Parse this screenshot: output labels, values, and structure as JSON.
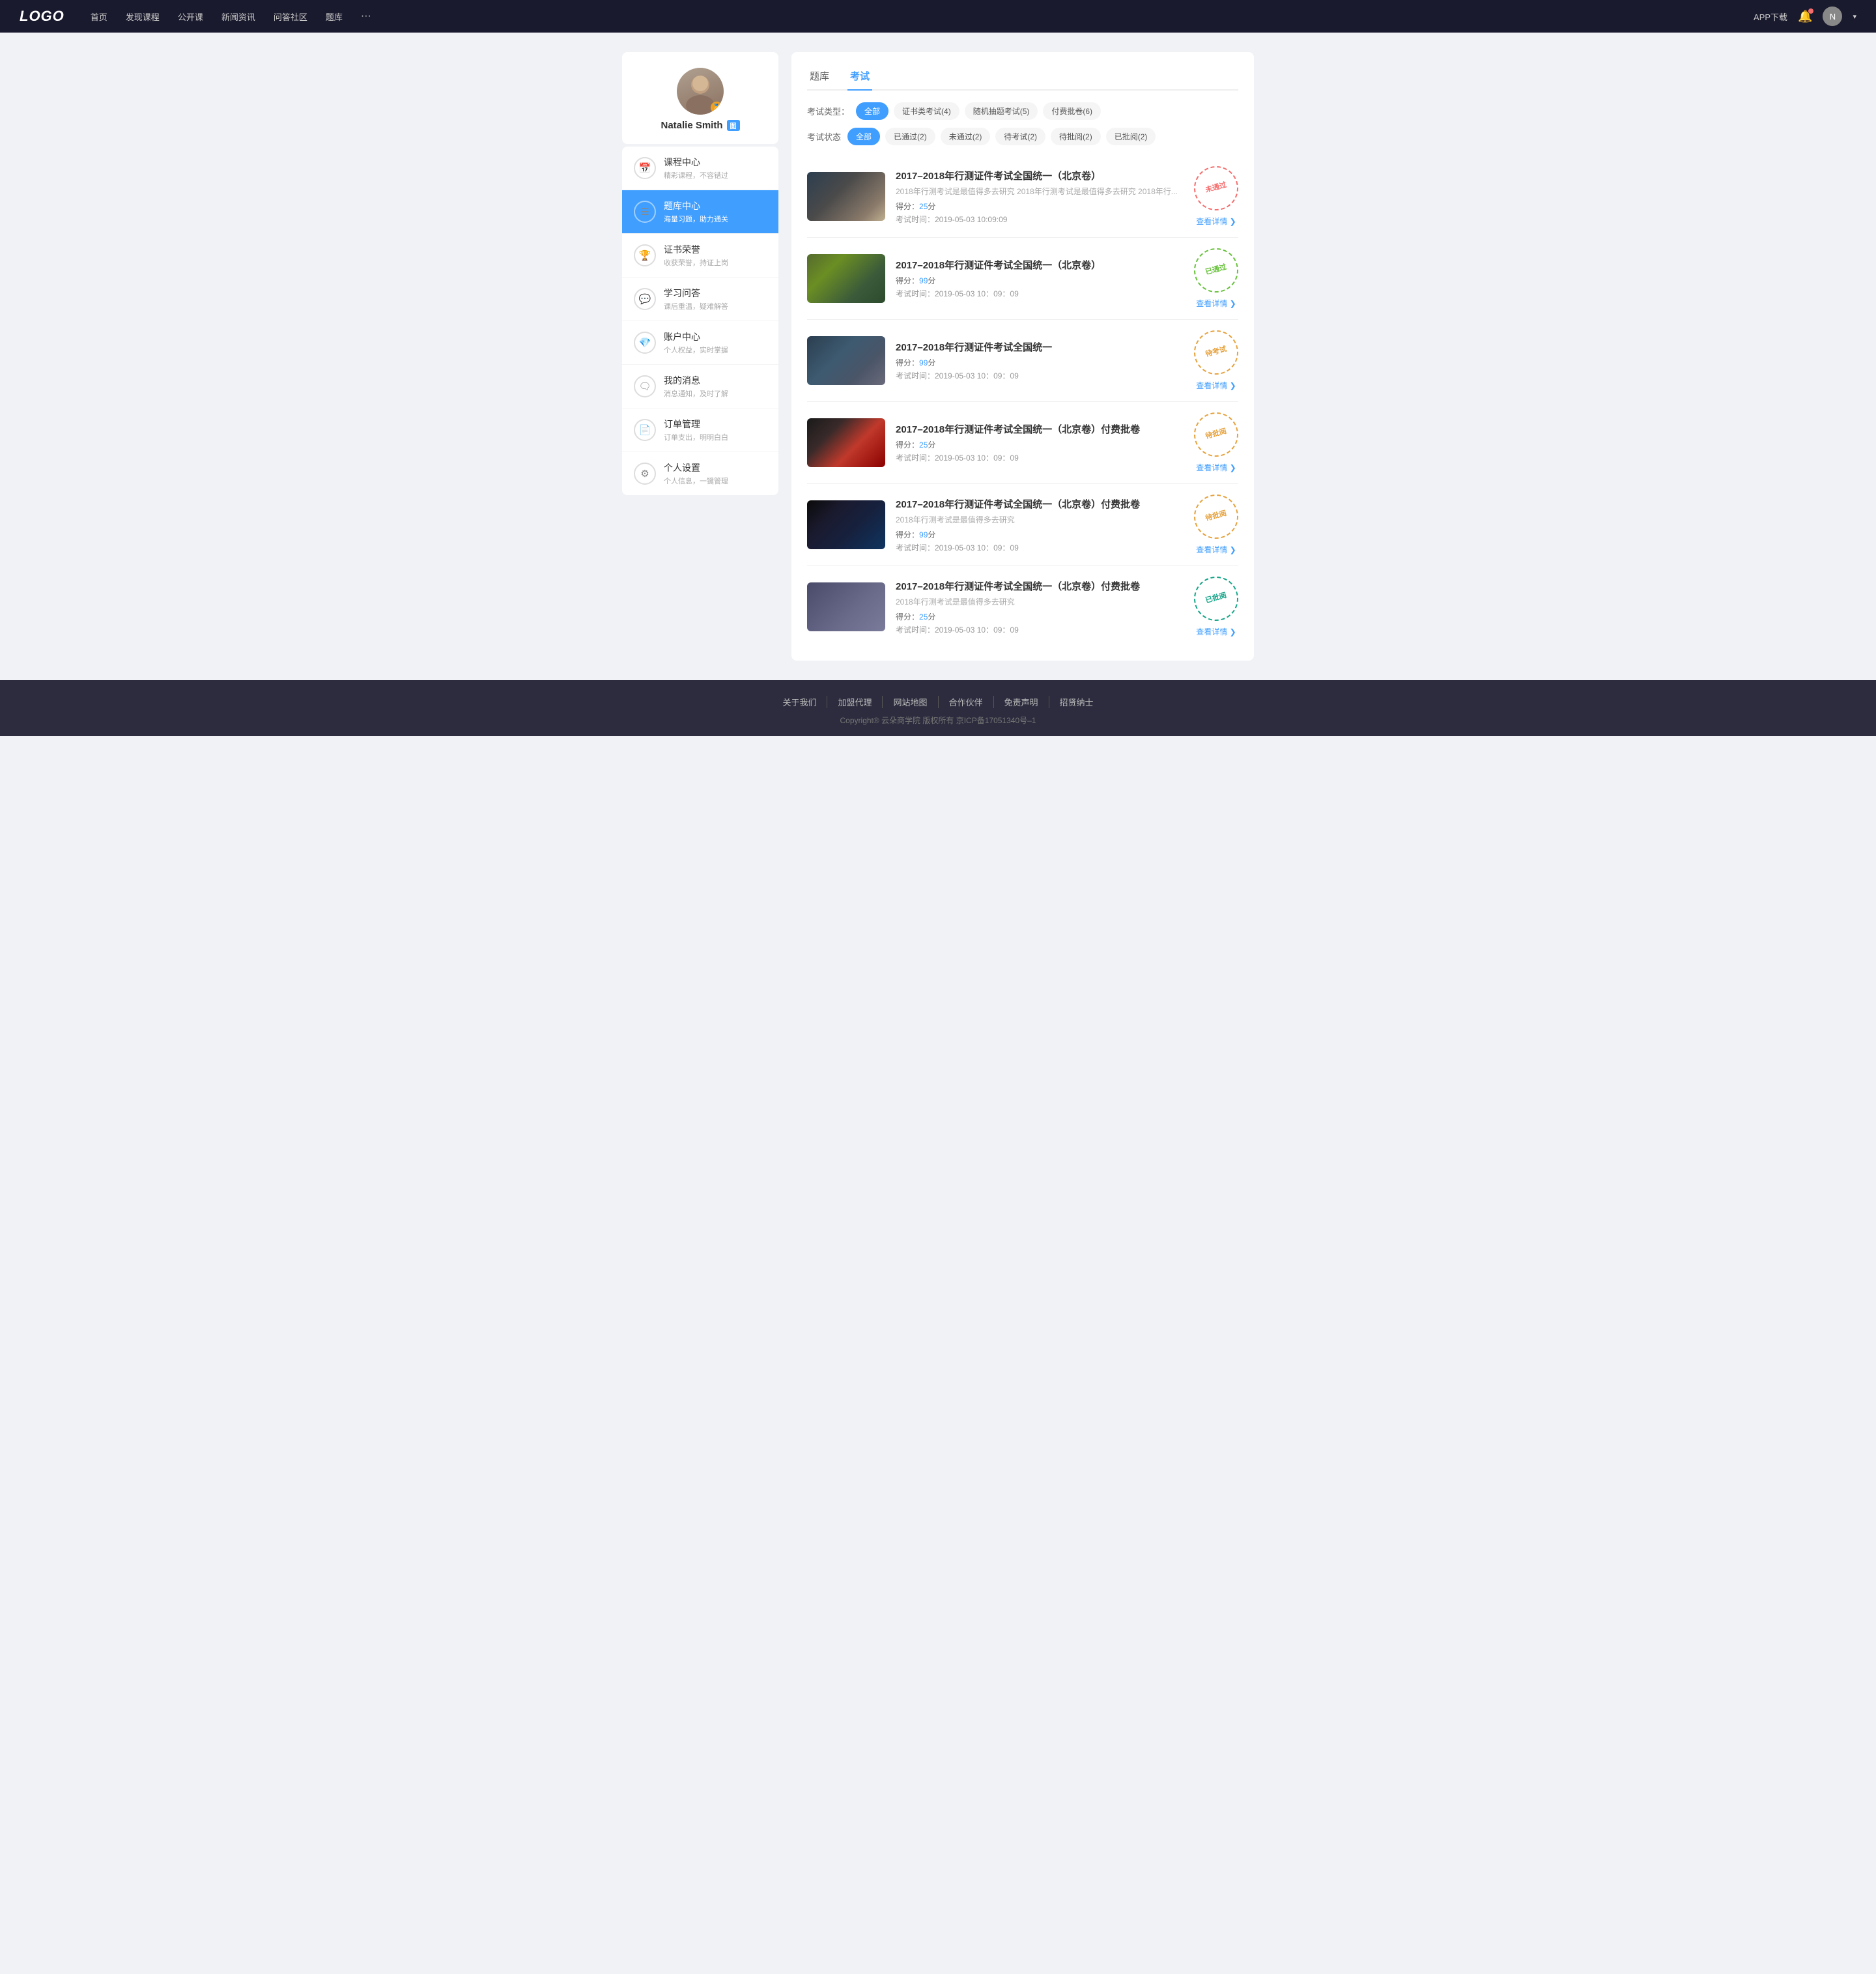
{
  "navbar": {
    "logo": "LOGO",
    "links": [
      {
        "label": "首页",
        "id": "home"
      },
      {
        "label": "发现课程",
        "id": "discover"
      },
      {
        "label": "公开课",
        "id": "opencourse"
      },
      {
        "label": "新闻资讯",
        "id": "news"
      },
      {
        "label": "问答社区",
        "id": "qa"
      },
      {
        "label": "题库",
        "id": "bank"
      }
    ],
    "more": "···",
    "app_download": "APP下载",
    "user_caret": "▾"
  },
  "sidebar": {
    "username": "Natalie Smith",
    "level_badge": "图",
    "menu_items": [
      {
        "id": "course-center",
        "title": "课程中心",
        "sub": "精彩课程，不容错过",
        "icon": "📅",
        "active": false
      },
      {
        "id": "question-bank",
        "title": "题库中心",
        "sub": "海量习题，助力通关",
        "icon": "☰",
        "active": true
      },
      {
        "id": "certificate",
        "title": "证书荣誉",
        "sub": "收获荣誉，持证上岗",
        "icon": "🏆",
        "active": false
      },
      {
        "id": "study-qa",
        "title": "学习问答",
        "sub": "课后重温，疑难解答",
        "icon": "💬",
        "active": false
      },
      {
        "id": "account",
        "title": "账户中心",
        "sub": "个人权益，实时掌握",
        "icon": "💎",
        "active": false
      },
      {
        "id": "messages",
        "title": "我的消息",
        "sub": "消息通知，及时了解",
        "icon": "🗨",
        "active": false
      },
      {
        "id": "orders",
        "title": "订单管理",
        "sub": "订单支出，明明白白",
        "icon": "📄",
        "active": false
      },
      {
        "id": "settings",
        "title": "个人设置",
        "sub": "个人信息，一键管理",
        "icon": "⚙",
        "active": false
      }
    ]
  },
  "content": {
    "tabs": [
      {
        "label": "题库",
        "id": "bank"
      },
      {
        "label": "考试",
        "id": "exam",
        "active": true
      }
    ],
    "filter_type": {
      "label": "考试类型：",
      "tags": [
        {
          "label": "全部",
          "active": true
        },
        {
          "label": "证书类考试(4)",
          "active": false
        },
        {
          "label": "随机抽题考试(5)",
          "active": false
        },
        {
          "label": "付费批卷(6)",
          "active": false
        }
      ]
    },
    "filter_status": {
      "label": "考试状态",
      "tags": [
        {
          "label": "全部",
          "active": true
        },
        {
          "label": "已通过(2)",
          "active": false
        },
        {
          "label": "未通过(2)",
          "active": false
        },
        {
          "label": "待考试(2)",
          "active": false
        },
        {
          "label": "待批阅(2)",
          "active": false
        },
        {
          "label": "已批阅(2)",
          "active": false
        }
      ]
    },
    "exam_list": [
      {
        "id": 1,
        "title": "2017–2018年行测证件考试全国统一（北京卷）",
        "desc": "2018年行测考试是最值得多去研究 2018年行测考试是最值得多去研究 2018年行...",
        "score_label": "得分：",
        "score": "25",
        "score_unit": "分",
        "time_label": "考试时间：",
        "time": "2019-05-03  10:09:09",
        "stamp_text": "未通过",
        "stamp_type": "red",
        "detail_label": "查看详情",
        "thumb_class": "thumb-1"
      },
      {
        "id": 2,
        "title": "2017–2018年行测证件考试全国统一（北京卷）",
        "desc": "",
        "score_label": "得分：",
        "score": "99",
        "score_unit": "分",
        "time_label": "考试时间：",
        "time": "2019-05-03  10：09：09",
        "stamp_text": "已通过",
        "stamp_type": "green",
        "detail_label": "查看详情",
        "thumb_class": "thumb-2"
      },
      {
        "id": 3,
        "title": "2017–2018年行测证件考试全国统一",
        "desc": "",
        "score_label": "得分：",
        "score": "99",
        "score_unit": "分",
        "time_label": "考试时间：",
        "time": "2019-05-03  10：09：09",
        "stamp_text": "待考试",
        "stamp_type": "yellow",
        "detail_label": "查看详情",
        "thumb_class": "thumb-3"
      },
      {
        "id": 4,
        "title": "2017–2018年行测证件考试全国统一（北京卷）付费批卷",
        "desc": "",
        "score_label": "得分：",
        "score": "25",
        "score_unit": "分",
        "time_label": "考试时间：",
        "time": "2019-05-03  10：09：09",
        "stamp_text": "待批阅",
        "stamp_type": "yellow",
        "detail_label": "查看详情",
        "thumb_class": "thumb-4"
      },
      {
        "id": 5,
        "title": "2017–2018年行测证件考试全国统一（北京卷）付费批卷",
        "desc": "2018年行测考试是最值得多去研究",
        "score_label": "得分：",
        "score": "99",
        "score_unit": "分",
        "time_label": "考试时间：",
        "time": "2019-05-03  10：09：09",
        "stamp_text": "待批阅",
        "stamp_type": "yellow",
        "detail_label": "查看详情",
        "thumb_class": "thumb-5"
      },
      {
        "id": 6,
        "title": "2017–2018年行测证件考试全国统一（北京卷）付费批卷",
        "desc": "2018年行测考试是最值得多去研究",
        "score_label": "得分：",
        "score": "25",
        "score_unit": "分",
        "time_label": "考试时间：",
        "time": "2019-05-03  10：09：09",
        "stamp_text": "已批阅",
        "stamp_type": "teal",
        "detail_label": "查看详情",
        "thumb_class": "thumb-6"
      }
    ]
  },
  "footer": {
    "links": [
      {
        "label": "关于我们"
      },
      {
        "label": "加盟代理"
      },
      {
        "label": "网站地图"
      },
      {
        "label": "合作伙伴"
      },
      {
        "label": "免责声明"
      },
      {
        "label": "招贤纳士"
      }
    ],
    "copyright": "Copyright® 云朵商学院  版权所有    京ICP备17051340号–1"
  }
}
